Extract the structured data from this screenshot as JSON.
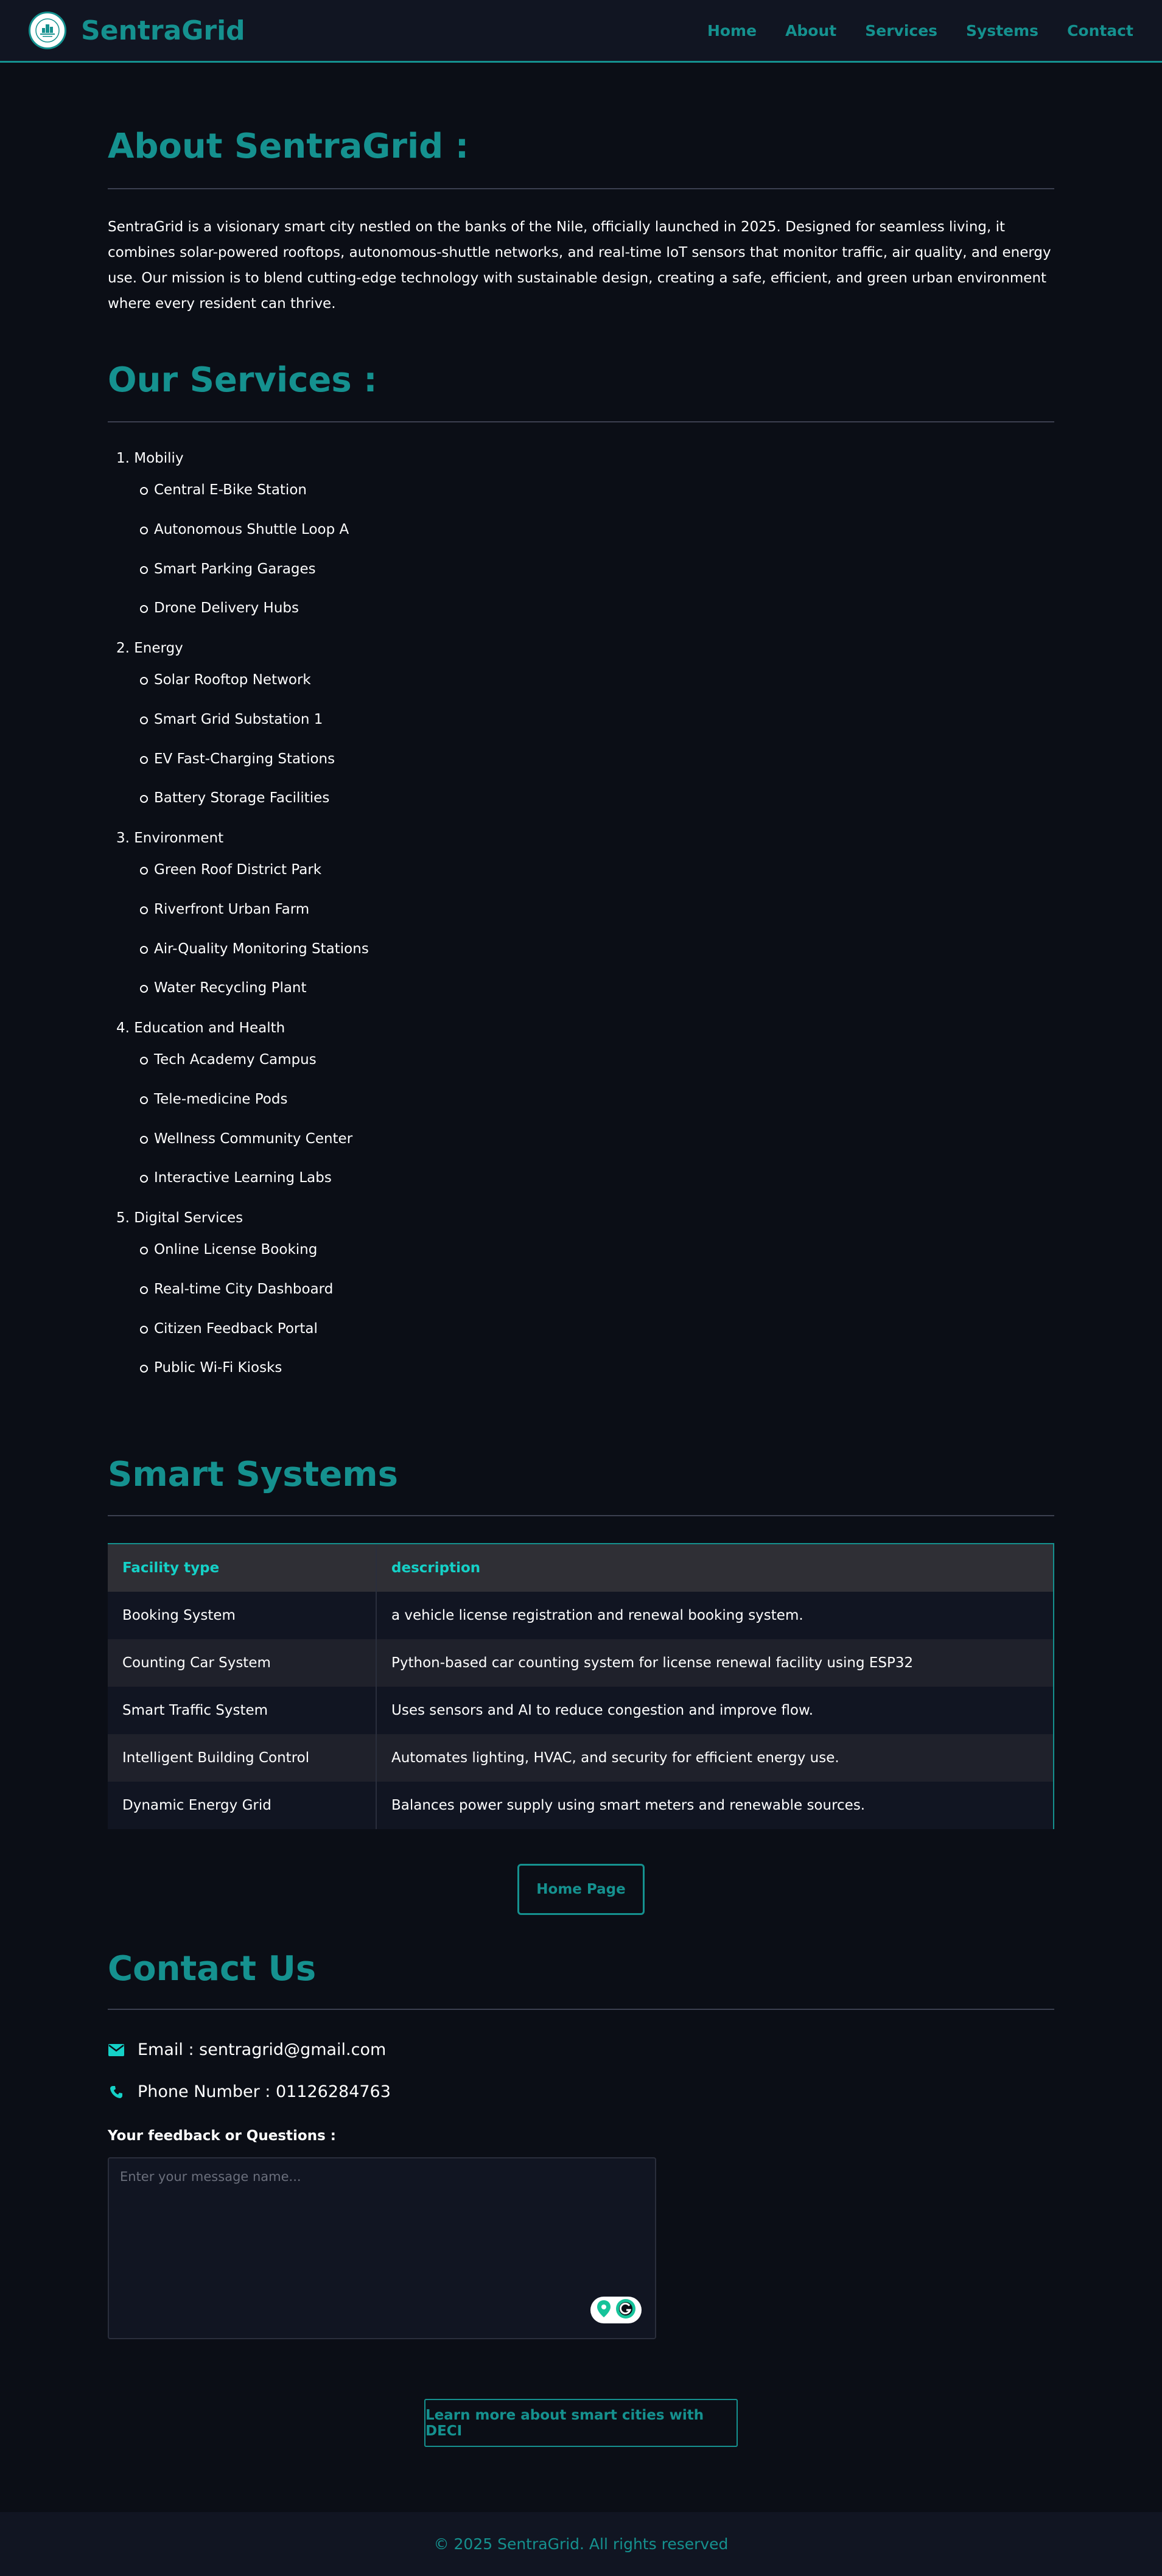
{
  "header": {
    "brand": "SentraGrid",
    "nav": [
      "Home",
      "About",
      "Services",
      "Systems",
      "Contact"
    ]
  },
  "about": {
    "title": "About SentraGrid :",
    "text": "SentraGrid is a visionary smart city nestled on the banks of the Nile, officially launched in 2025. Designed for seamless living, it combines solar-powered rooftops, autonomous-shuttle networks, and real-time IoT sensors that monitor traffic, air quality, and energy use. Our mission is to blend cutting-edge technology with sustainable design, creating a safe, efficient, and green urban environment where every resident can thrive."
  },
  "services": {
    "title": "Our Services :",
    "categories": [
      {
        "label": "1. Mobiliy",
        "items": [
          "Central E-Bike Station",
          "Autonomous Shuttle Loop A",
          "Smart Parking Garages",
          "Drone Delivery Hubs"
        ]
      },
      {
        "label": "2. Energy",
        "items": [
          "Solar Rooftop Network",
          "Smart Grid Substation 1",
          "EV Fast-Charging Stations",
          "Battery Storage Facilities"
        ]
      },
      {
        "label": "3. Environment",
        "items": [
          "Green Roof District Park",
          "Riverfront Urban Farm",
          "Air-Quality Monitoring Stations",
          "Water Recycling Plant"
        ]
      },
      {
        "label": "4. Education and Health",
        "items": [
          "Tech Academy Campus",
          "Tele-medicine Pods",
          "Wellness Community Center",
          "Interactive Learning Labs"
        ]
      },
      {
        "label": "5. Digital Services",
        "items": [
          "Online License Booking",
          "Real-time City Dashboard",
          "Citizen Feedback Portal",
          "Public Wi-Fi Kiosks"
        ]
      }
    ]
  },
  "systems": {
    "title": "Smart Systems",
    "columns": [
      "Facility type",
      "description"
    ],
    "rows": [
      [
        "Booking System",
        "a vehicle license registration and renewal booking system."
      ],
      [
        "Counting Car System",
        "Python-based car counting system for license renewal facility using ESP32"
      ],
      [
        "Smart Traffic System",
        "Uses sensors and AI to reduce congestion and improve flow."
      ],
      [
        "Intelligent Building Control",
        "Automates lighting, HVAC, and security for efficient energy use."
      ],
      [
        "Dynamic Energy Grid",
        "Balances power supply using smart meters and renewable sources."
      ]
    ],
    "home_button": "Home Page"
  },
  "contact": {
    "title": "Contact Us",
    "email": "Email : sentragrid@gmail.com",
    "phone": "Phone Number : 01126284763",
    "feedback_label": "Your feedback or Questions :",
    "placeholder": "Enter your message name...",
    "learn_more": "Learn more about smart cities with DECI"
  },
  "footer": {
    "text": "© 2025 SentraGrid. All rights reserved"
  },
  "colors": {
    "accent": "#15918f",
    "accent_light": "#15d1c7",
    "background": "#0b0e16",
    "header_bg": "#111522"
  }
}
